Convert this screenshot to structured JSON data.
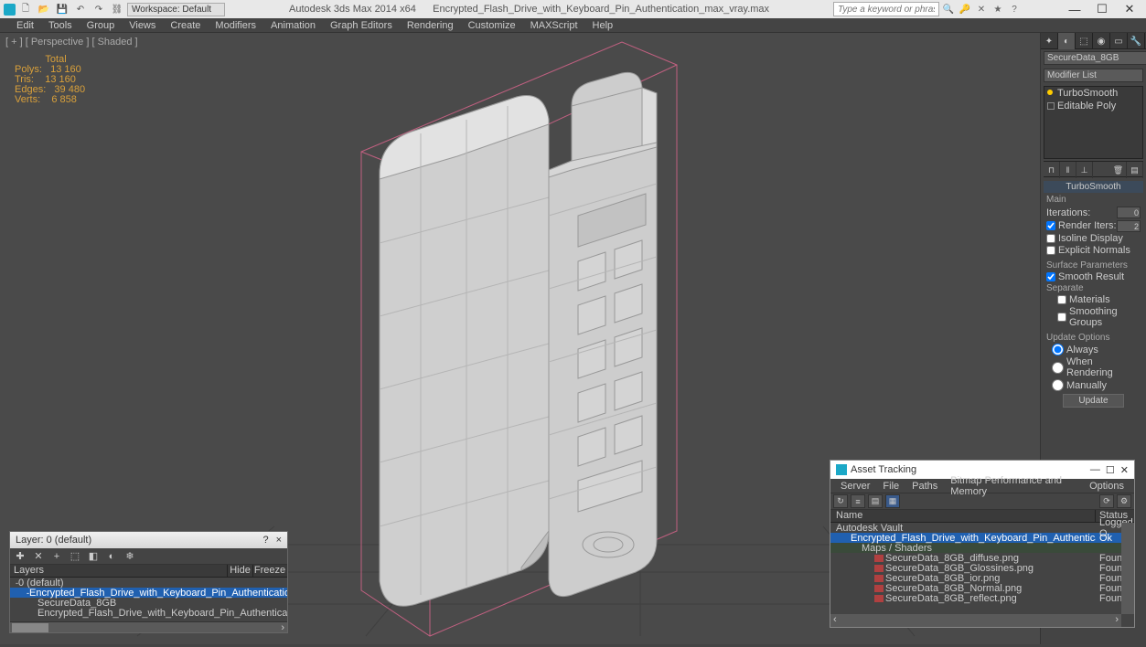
{
  "titlebar": {
    "workspace_label": "Workspace: Default",
    "app_title": "Autodesk 3ds Max 2014 x64",
    "file_title": "Encrypted_Flash_Drive_with_Keyboard_Pin_Authentication_max_vray.max",
    "search_placeholder": "Type a keyword or phrase"
  },
  "menubar": [
    "Edit",
    "Tools",
    "Group",
    "Views",
    "Create",
    "Modifiers",
    "Animation",
    "Graph Editors",
    "Rendering",
    "Customize",
    "MAXScript",
    "Help"
  ],
  "viewport": {
    "label": "[ + ] [ Perspective ] [ Shaded ]",
    "stats": {
      "header": "           Total",
      "polys": "Polys:   13 160",
      "tris": "Tris:    13 160",
      "edges": "Edges:   39 480",
      "verts": "Verts:    6 858"
    }
  },
  "command_panel": {
    "object_name": "SecureData_8GB",
    "modifier_list_label": "Modifier List",
    "modifiers": [
      "TurboSmooth",
      "Editable Poly"
    ],
    "rollout_title": "TurboSmooth",
    "groups": {
      "main": "Main",
      "iterations_label": "Iterations:",
      "iterations_val": "0",
      "render_iters_label": "Render Iters:",
      "render_iters_val": "2",
      "isoline": "Isoline Display",
      "explicit": "Explicit Normals",
      "surface": "Surface Parameters",
      "smooth_result": "Smooth Result",
      "separate": "Separate",
      "materials": "Materials",
      "smoothing_groups": "Smoothing Groups",
      "update_options": "Update Options",
      "always": "Always",
      "when_rendering": "When Rendering",
      "manually": "Manually",
      "update_btn": "Update"
    }
  },
  "layer_panel": {
    "title": "Layer: 0 (default)",
    "col_layers": "Layers",
    "col_hide": "Hide",
    "col_freeze": "Freeze",
    "rows": [
      {
        "indent": 0,
        "exp": "-",
        "name": "0 (default)",
        "sel": false
      },
      {
        "indent": 1,
        "exp": "-",
        "name": "Encrypted_Flash_Drive_with_Keyboard_Pin_Authentication",
        "sel": true
      },
      {
        "indent": 2,
        "exp": "",
        "name": "SecureData_8GB",
        "sel": false
      },
      {
        "indent": 2,
        "exp": "",
        "name": "Encrypted_Flash_Drive_with_Keyboard_Pin_Authentication",
        "sel": false
      }
    ]
  },
  "asset_panel": {
    "title": "Asset Tracking",
    "menus": [
      "Server",
      "File",
      "Paths",
      "Bitmap Performance and Memory",
      "Options"
    ],
    "col_name": "Name",
    "col_status": "Status",
    "rows": [
      {
        "type": "root",
        "indent": 0,
        "name": "Autodesk Vault",
        "status": "Logged O",
        "sel": false
      },
      {
        "type": "file",
        "indent": 1,
        "name": "Encrypted_Flash_Drive_with_Keyboard_Pin_Authentication_max_vray.max",
        "status": "Ok",
        "sel": true
      },
      {
        "type": "group",
        "indent": 2,
        "name": "Maps / Shaders",
        "status": "",
        "sel": false
      },
      {
        "type": "map",
        "indent": 3,
        "name": "SecureData_8GB_diffuse.png",
        "status": "Found",
        "sel": false
      },
      {
        "type": "map",
        "indent": 3,
        "name": "SecureData_8GB_Glossines.png",
        "status": "Found",
        "sel": false
      },
      {
        "type": "map",
        "indent": 3,
        "name": "SecureData_8GB_ior.png",
        "status": "Found",
        "sel": false
      },
      {
        "type": "map",
        "indent": 3,
        "name": "SecureData_8GB_Normal.png",
        "status": "Found",
        "sel": false
      },
      {
        "type": "map",
        "indent": 3,
        "name": "SecureData_8GB_reflect.png",
        "status": "Found",
        "sel": false
      }
    ]
  }
}
